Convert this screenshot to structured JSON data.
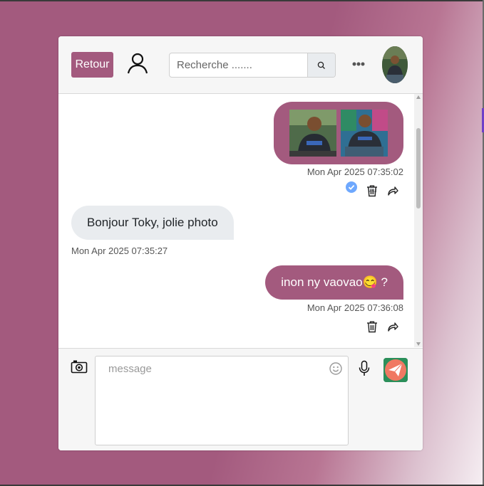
{
  "header": {
    "back_label": "Retour",
    "search_placeholder": "Recherche ......."
  },
  "messages": [
    {
      "direction": "out",
      "type": "photos",
      "photo_count": 2,
      "timestamp": "Mon Apr 2025 07:35:02",
      "status": "vu"
    },
    {
      "direction": "in",
      "type": "text",
      "text": "Bonjour Toky, jolie photo",
      "timestamp": "Mon Apr 2025 07:35:27"
    },
    {
      "direction": "out",
      "type": "text",
      "text": "inon ny vaovao😋 ?",
      "timestamp": "Mon Apr 2025 07:36:08"
    }
  ],
  "composer": {
    "placeholder": "message"
  },
  "colors": {
    "accent": "#a35a7e",
    "incoming_bubble": "#e9ecef",
    "seen_check": "#6ea8fe",
    "send_bg": "#2b8f5a",
    "send_fg": "#f07862"
  },
  "icons": [
    "user-icon",
    "search-icon",
    "more-icon",
    "trash-icon",
    "share-icon",
    "camera-icon",
    "emoji-icon",
    "microphone-icon",
    "send-icon",
    "check-icon"
  ]
}
